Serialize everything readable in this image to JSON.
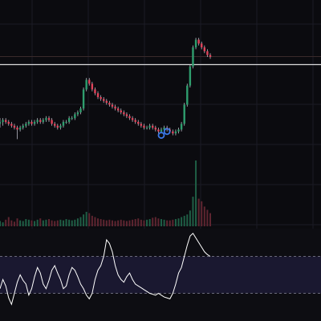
{
  "theme": {
    "background": "#0b0b0f",
    "grid": "#1b1b24",
    "up": "#2f9e6e",
    "down": "#e0435a",
    "wick": "#b9b9c4",
    "horizontal_line": "#d9d9d9",
    "marker": "#3b78e7",
    "rsi_line": "#ffffff",
    "rsi_band": "#1a1830",
    "rsi_guides": "#6a6a7a"
  },
  "chart_data": [
    {
      "type": "candlestick",
      "horizontal_line": {
        "value": 86
      },
      "markers": [
        {
          "x": 56,
          "value": 49,
          "shape": "circle"
        },
        {
          "x": 58,
          "value": 51,
          "shape": "circle"
        }
      ],
      "x": [
        0,
        1,
        2,
        3,
        4,
        5,
        6,
        7,
        8,
        9,
        10,
        11,
        12,
        13,
        14,
        15,
        16,
        17,
        18,
        19,
        20,
        21,
        22,
        23,
        24,
        25,
        26,
        27,
        28,
        29,
        30,
        31,
        32,
        33,
        34,
        35,
        36,
        37,
        38,
        39,
        40,
        41,
        42,
        43,
        44,
        45,
        46,
        47,
        48,
        49,
        50,
        51,
        52,
        53,
        54,
        55,
        56,
        57,
        58,
        59,
        60,
        61,
        62,
        63,
        64,
        65,
        66,
        67,
        68,
        69,
        70,
        71,
        72,
        73
      ],
      "open": [
        55,
        56,
        57,
        56,
        55,
        54,
        53,
        52,
        53,
        54,
        55,
        56,
        55,
        56,
        57,
        56,
        57,
        58,
        57,
        55,
        54,
        53,
        54,
        56,
        56,
        58,
        58,
        60,
        61,
        63,
        73,
        78,
        76,
        73,
        71,
        69,
        68,
        67,
        66,
        65,
        64,
        63,
        62,
        61,
        60,
        59,
        58,
        57,
        56,
        55,
        54,
        53,
        53,
        54,
        53,
        52,
        51,
        52,
        53,
        52,
        51,
        50,
        51,
        52,
        55,
        65,
        75,
        85,
        95,
        99,
        97,
        95,
        93,
        91
      ],
      "close": [
        56,
        57,
        56,
        55,
        54,
        53,
        52,
        53,
        54,
        55,
        56,
        55,
        56,
        57,
        56,
        57,
        58,
        57,
        55,
        54,
        53,
        54,
        56,
        56,
        58,
        58,
        60,
        61,
        63,
        73,
        78,
        76,
        73,
        71,
        69,
        68,
        67,
        66,
        65,
        64,
        63,
        62,
        61,
        60,
        59,
        58,
        57,
        56,
        55,
        54,
        53,
        53,
        54,
        53,
        52,
        51,
        52,
        53,
        52,
        51,
        50,
        51,
        52,
        55,
        65,
        75,
        85,
        95,
        99,
        97,
        95,
        93,
        91,
        90
      ],
      "high": [
        58,
        58,
        58,
        57,
        56,
        55,
        54,
        54,
        55,
        56,
        57,
        57,
        57,
        58,
        58,
        58,
        59,
        59,
        58,
        56,
        55,
        55,
        57,
        57,
        59,
        59,
        61,
        62,
        64,
        74,
        79,
        79,
        77,
        74,
        72,
        70,
        69,
        68,
        67,
        66,
        65,
        64,
        63,
        62,
        61,
        60,
        59,
        58,
        57,
        56,
        55,
        54,
        55,
        55,
        54,
        53,
        53,
        54,
        54,
        53,
        52,
        52,
        53,
        56,
        66,
        76,
        86,
        96,
        100,
        100,
        98,
        96,
        94,
        92
      ],
      "low": [
        53,
        54,
        55,
        54,
        53,
        52,
        47,
        51,
        52,
        53,
        54,
        54,
        54,
        55,
        55,
        55,
        56,
        56,
        54,
        53,
        52,
        52,
        53,
        55,
        55,
        57,
        57,
        59,
        60,
        62,
        72,
        75,
        72,
        70,
        68,
        67,
        66,
        65,
        64,
        63,
        62,
        61,
        60,
        59,
        58,
        57,
        56,
        55,
        54,
        53,
        52,
        52,
        52,
        52,
        51,
        50,
        50,
        51,
        51,
        50,
        49,
        49,
        50,
        51,
        54,
        64,
        74,
        84,
        94,
        96,
        94,
        92,
        90,
        89
      ]
    },
    {
      "type": "bar",
      "series": [
        {
          "values": [
            8,
            6,
            10,
            14,
            9,
            7,
            12,
            9,
            8,
            11,
            10,
            9,
            8,
            10,
            12,
            9,
            10,
            11,
            9,
            8,
            9,
            10,
            9,
            11,
            10,
            9,
            10,
            12,
            14,
            18,
            22,
            20,
            16,
            14,
            12,
            11,
            10,
            9,
            10,
            9,
            8,
            9,
            10,
            9,
            8,
            9,
            10,
            11,
            12,
            10,
            9,
            10,
            11,
            13,
            14,
            12,
            11,
            10,
            9,
            9,
            10,
            11,
            12,
            14,
            16,
            18,
            24,
            45,
            100,
            42,
            38,
            30,
            25,
            20
          ]
        }
      ]
    },
    {
      "type": "line",
      "guides": [
        70,
        30
      ],
      "series": [
        {
          "values": [
            35,
            45,
            38,
            25,
            18,
            30,
            42,
            50,
            44,
            40,
            28,
            35,
            48,
            58,
            52,
            40,
            35,
            44,
            55,
            60,
            52,
            45,
            35,
            38,
            50,
            58,
            55,
            48,
            40,
            35,
            28,
            24,
            30,
            45,
            55,
            60,
            70,
            88,
            84,
            75,
            60,
            50,
            45,
            42,
            48,
            52,
            45,
            40,
            38,
            36,
            34,
            32,
            30,
            29,
            28,
            30,
            28,
            26,
            25,
            24,
            30,
            40,
            52,
            58,
            70,
            82,
            92,
            95,
            90,
            85,
            80,
            75,
            72,
            70
          ]
        }
      ]
    }
  ]
}
